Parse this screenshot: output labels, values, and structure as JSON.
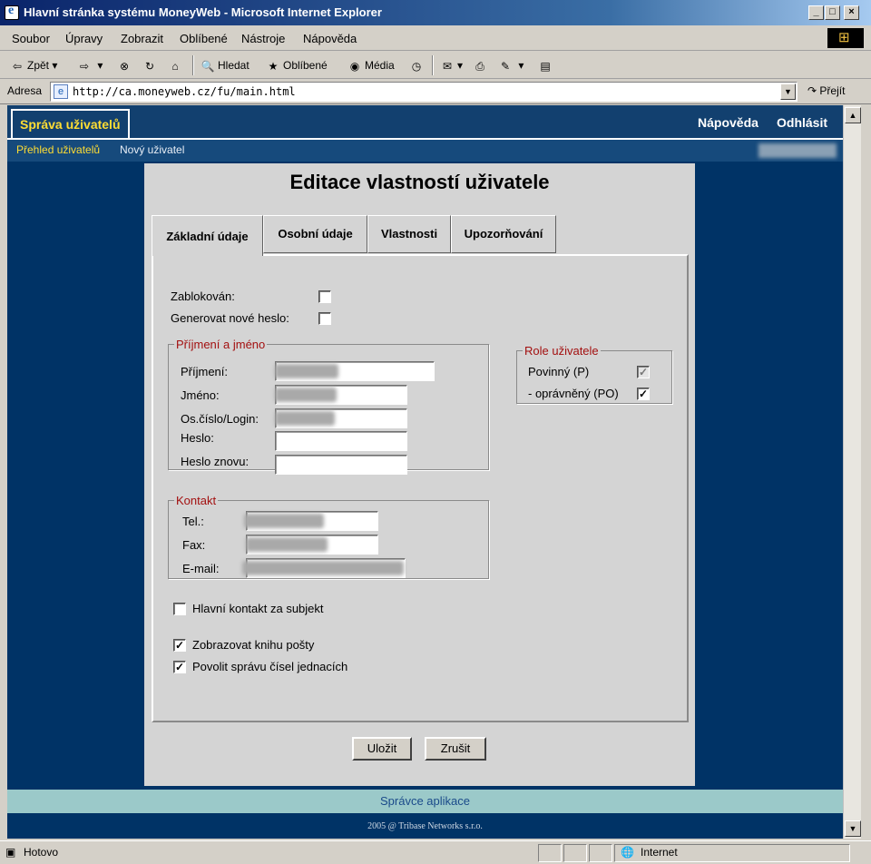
{
  "window": {
    "title": "Hlavní stránka systému MoneyWeb - Microsoft Internet Explorer",
    "controls": [
      "_",
      "□",
      "×"
    ]
  },
  "menu": [
    "Soubor",
    "Úpravy",
    "Zobrazit",
    "Oblíbené",
    "Nástroje",
    "Nápověda"
  ],
  "toolbar": {
    "back": "Zpět",
    "search": "Hledat",
    "favorites": "Oblíbené",
    "media": "Média"
  },
  "address": {
    "label": "Adresa",
    "url": "http://ca.moneyweb.cz/fu/main.html",
    "go": "Přejít"
  },
  "app": {
    "section_tab": "Správa uživatelů",
    "help": "Nápověda",
    "logout": "Odhlásit",
    "subnav": [
      "Přehled uživatelů",
      "Nový uživatel"
    ]
  },
  "form": {
    "title": "Editace vlastností uživatele",
    "tabs": [
      "Základní údaje",
      "Osobní údaje",
      "Vlastnosti",
      "Upozorňování"
    ],
    "active_tab": "Základní údaje",
    "blocked_label": "Zablokován:",
    "blocked": false,
    "new_password_label": "Generovat nové heslo:",
    "new_password": false,
    "name_group": {
      "legend": "Příjmení a jméno",
      "fields": [
        "Příjmení:",
        "Jméno:",
        "Os.číslo/Login:",
        "Heslo:",
        "Heslo znovu:"
      ]
    },
    "role_group": {
      "legend": "Role uživatele",
      "roles": [
        {
          "label": "Povinný (P)",
          "checked": true,
          "disabled": true
        },
        {
          "label": "- oprávněný (PO)",
          "checked": true,
          "disabled": false
        }
      ]
    },
    "contact_group": {
      "legend": "Kontakt",
      "fields": [
        "Tel.:",
        "Fax:",
        "E-mail:"
      ]
    },
    "main_contact_label": "Hlavní kontakt za subjekt",
    "main_contact": false,
    "show_mailbook_label": "Zobrazovat knihu pošty",
    "show_mailbook": true,
    "allow_refnum_label": "Povolit správu čísel jednacích",
    "allow_refnum": true,
    "save": "Uložit",
    "cancel": "Zrušit"
  },
  "footer": {
    "admin": "Správce aplikace",
    "copyright": "2005 @ Tribase Networks s.r.o."
  },
  "status": {
    "text": "Hotovo",
    "zone": "Internet"
  },
  "colors": {
    "page_bg": "#003366",
    "accent_yellow": "#ffdd33",
    "legend_red": "#a31010",
    "footer_band": "#9bc9c9"
  }
}
